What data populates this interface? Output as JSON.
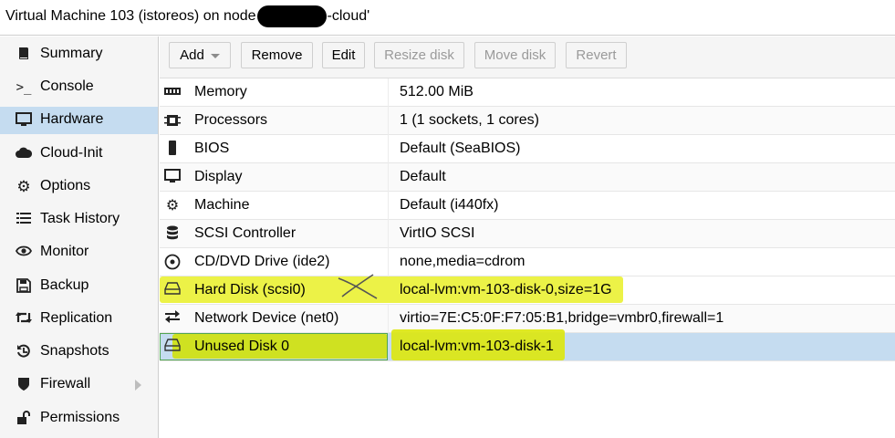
{
  "window": {
    "title_prefix": "Virtual Machine 103 (istoreos) on node",
    "title_suffix": "-cloud'"
  },
  "sidebar": {
    "items": [
      {
        "label": "Summary",
        "icon": "book-icon",
        "glyph": "📘"
      },
      {
        "label": "Console",
        "icon": "terminal-icon",
        "glyph": ">_"
      },
      {
        "label": "Hardware",
        "icon": "monitor-icon",
        "glyph": "🖵"
      },
      {
        "label": "Cloud-Init",
        "icon": "cloud-icon",
        "glyph": "☁"
      },
      {
        "label": "Options",
        "icon": "gear-icon",
        "glyph": "⚙"
      },
      {
        "label": "Task History",
        "icon": "list-icon",
        "glyph": "☰"
      },
      {
        "label": "Monitor",
        "icon": "eye-icon",
        "glyph": "◉"
      },
      {
        "label": "Backup",
        "icon": "floppy-icon",
        "glyph": "🖫"
      },
      {
        "label": "Replication",
        "icon": "retweet-icon",
        "glyph": "⇄"
      },
      {
        "label": "Snapshots",
        "icon": "history-icon",
        "glyph": "↺"
      },
      {
        "label": "Firewall",
        "icon": "shield-icon",
        "glyph": "⛉"
      },
      {
        "label": "Permissions",
        "icon": "unlock-icon",
        "glyph": "🔓"
      }
    ],
    "selected": "Hardware"
  },
  "toolbar": {
    "add_label": "Add",
    "remove_label": "Remove",
    "edit_label": "Edit",
    "resize_label": "Resize disk",
    "move_label": "Move disk",
    "revert_label": "Revert"
  },
  "hardware": {
    "rows": [
      {
        "name": "Memory",
        "value": "512.00 MiB",
        "icon": "memory-icon",
        "glyph": "▥"
      },
      {
        "name": "Processors",
        "value": "1 (1 sockets, 1 cores)",
        "icon": "cpu-icon",
        "glyph": "▣"
      },
      {
        "name": "BIOS",
        "value": "Default (SeaBIOS)",
        "icon": "chip-icon",
        "glyph": "▮"
      },
      {
        "name": "Display",
        "value": "Default",
        "icon": "display-icon",
        "glyph": "🖵"
      },
      {
        "name": "Machine",
        "value": "Default (i440fx)",
        "icon": "cogs-icon",
        "glyph": "⚙"
      },
      {
        "name": "SCSI Controller",
        "value": "VirtIO SCSI",
        "icon": "database-icon",
        "glyph": "≣"
      },
      {
        "name": "CD/DVD Drive (ide2)",
        "value": "none,media=cdrom",
        "icon": "cdrom-icon",
        "glyph": "◎"
      },
      {
        "name": "Hard Disk (scsi0)",
        "value": "local-lvm:vm-103-disk-0,size=1G",
        "icon": "hdd-icon",
        "glyph": "⊟"
      },
      {
        "name": "Network Device (net0)",
        "value": "virtio=7E:C5:0F:F7:05:B1,bridge=vmbr0,firewall=1",
        "icon": "exchange-icon",
        "glyph": "⇄"
      },
      {
        "name": "Unused Disk 0",
        "value": "local-lvm:vm-103-disk-1",
        "icon": "hdd-icon",
        "glyph": "⊟"
      }
    ]
  }
}
